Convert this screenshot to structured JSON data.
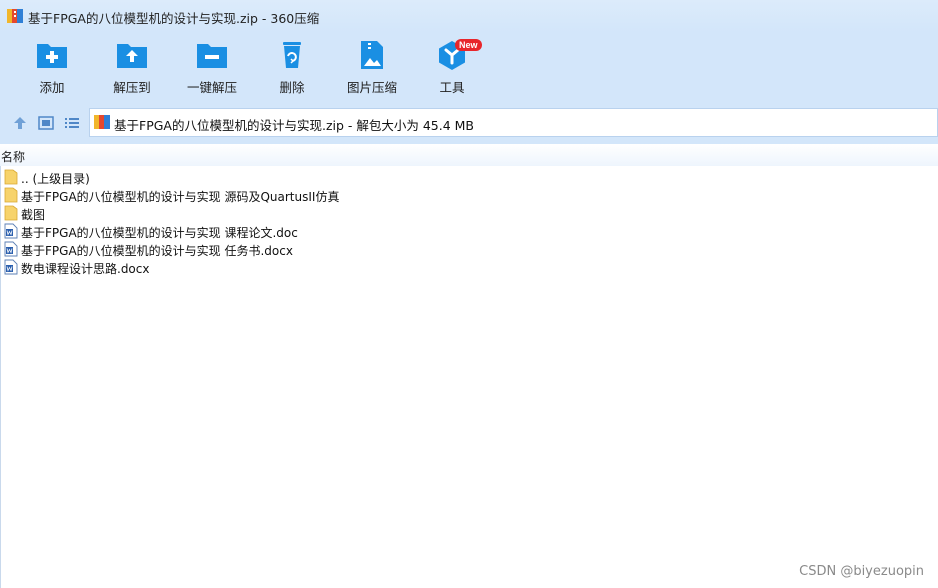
{
  "window": {
    "title": "基于FPGA的八位模型机的设计与实现.zip - 360压缩"
  },
  "toolbar": {
    "items": [
      {
        "label": "添加",
        "icon": "add-folder-icon"
      },
      {
        "label": "解压到",
        "icon": "extract-to-folder-icon"
      },
      {
        "label": "一键解压",
        "icon": "one-click-extract-icon"
      },
      {
        "label": "删除",
        "icon": "recycle-bin-icon"
      },
      {
        "label": "图片压缩",
        "icon": "image-compress-icon"
      },
      {
        "label": "工具",
        "icon": "tools-hexagon-icon",
        "badge": "New"
      }
    ]
  },
  "address": {
    "path": "基于FPGA的八位模型机的设计与实现.zip - 解包大小为 45.4 MB"
  },
  "list": {
    "column_name": "名称",
    "items": [
      {
        "name": ".. (上级目录)",
        "type": "folder"
      },
      {
        "name": "基于FPGA的八位模型机的设计与实现 源码及QuartusII仿真",
        "type": "folder"
      },
      {
        "name": "截图",
        "type": "folder"
      },
      {
        "name": "基于FPGA的八位模型机的设计与实现 课程论文.doc",
        "type": "word"
      },
      {
        "name": "基于FPGA的八位模型机的设计与实现 任务书.docx",
        "type": "word"
      },
      {
        "name": "数电课程设计思路.docx",
        "type": "word"
      }
    ]
  },
  "watermark": "CSDN @biyezuopin",
  "colors": {
    "accent": "#1a8fe3",
    "toolbar_bg": "#d3e6fa",
    "badge": "#e8262b",
    "folder": "#f7d36b"
  }
}
